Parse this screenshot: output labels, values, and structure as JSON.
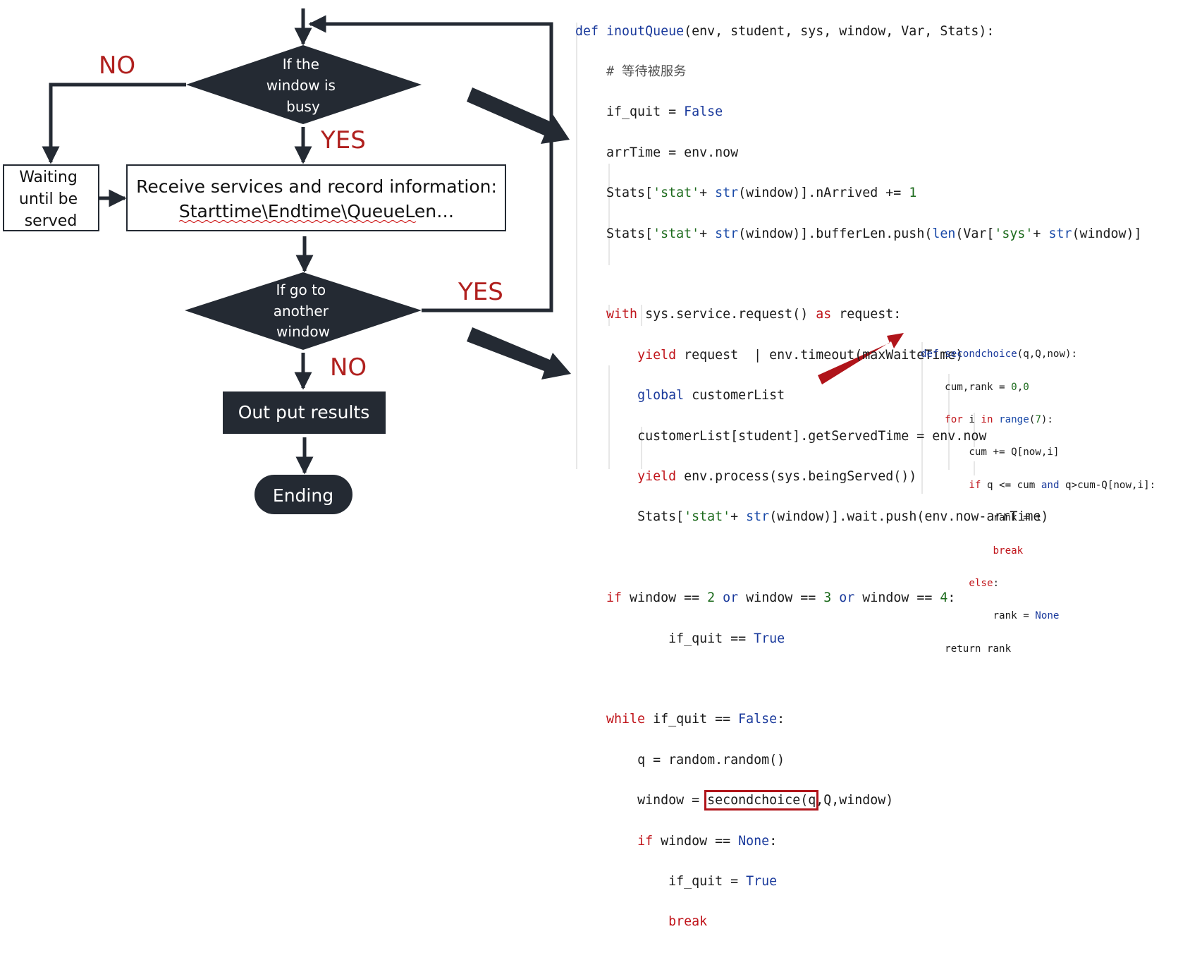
{
  "flowchart": {
    "decision1": [
      "If the",
      "window is",
      "busy"
    ],
    "no_label_1": "NO",
    "yes_label_1": "YES",
    "wait_box": [
      "Waiting",
      "until be",
      "served"
    ],
    "receive_box": [
      "Receive services and record information:",
      "Starttime\\Endtime\\QueueLen…"
    ],
    "decision2": [
      "If go to",
      "another",
      "window"
    ],
    "yes_label_2": "YES",
    "no_label_2": "NO",
    "output_box": "Out put results",
    "ending": "Ending"
  },
  "colors": {
    "dark_shape": "#242a33",
    "label_red": "#b0201e",
    "highlight_red": "#b0141a",
    "keyword_red": "#c0141a",
    "keyword_blue": "#1a3a9c",
    "string_green": "#1b6a1b"
  },
  "code_main": {
    "l1": [
      "def",
      " ",
      "inoutQueue",
      "(env, student, sys, window, Var, Stats):"
    ],
    "l2": "# 等待被服务",
    "l3": [
      "if_quit = ",
      "False"
    ],
    "l4": "arrTime = env.now",
    "l5": [
      "Stats[",
      "'stat'",
      "+ ",
      "str",
      "(window)].nArrived += ",
      "1"
    ],
    "l6": [
      "Stats[",
      "'stat'",
      "+ ",
      "str",
      "(window)].bufferLen.push(",
      "len",
      "(Var[",
      "'sys'",
      "+ ",
      "str",
      "(window)]"
    ],
    "l8": [
      "with",
      " sys.service.request() ",
      "as",
      " request:"
    ],
    "l9": [
      "yield",
      " request  | env.timeout(maxWaiteTime)"
    ],
    "l10": [
      "global",
      " customerList"
    ],
    "l11": "customerList[student].getServedTime = env.now",
    "l12": [
      "yield",
      " env.process(sys.beingServed())"
    ],
    "l13": [
      "Stats[",
      "'stat'",
      "+ ",
      "str",
      "(window)].wait.push(env.now-arrTime)"
    ],
    "l15": [
      "if",
      " window == ",
      "2",
      " ",
      "or",
      " window == ",
      "3",
      " ",
      "or",
      " window == ",
      "4",
      ":"
    ],
    "l16": [
      "if_quit == ",
      "True"
    ],
    "l18": [
      "while",
      " if_quit == ",
      "False",
      ":"
    ],
    "l19": "q = random.random()",
    "l20": [
      "window = ",
      "secondchoice(q",
      ",Q,window)"
    ],
    "l21": [
      "if",
      " window == ",
      "None",
      ":"
    ],
    "l22": [
      "if_quit = ",
      "True"
    ],
    "l23": "break"
  },
  "code_small": {
    "s1": [
      "def",
      " ",
      "secondchoice",
      "(q,Q,now):"
    ],
    "s2": [
      "cum,rank = ",
      "0",
      ",",
      "0"
    ],
    "s3": [
      "for",
      " i ",
      "in",
      " ",
      "range",
      "(",
      "7",
      "):"
    ],
    "s4": "cum += Q[now,i]",
    "s5": [
      "if",
      " q <= cum ",
      "and",
      " q>cum-Q[now,i]:"
    ],
    "s6": "rank = i",
    "s7": "break",
    "s8": [
      "else",
      ":"
    ],
    "s9": [
      "rank = ",
      "None"
    ],
    "s10": "return rank"
  }
}
